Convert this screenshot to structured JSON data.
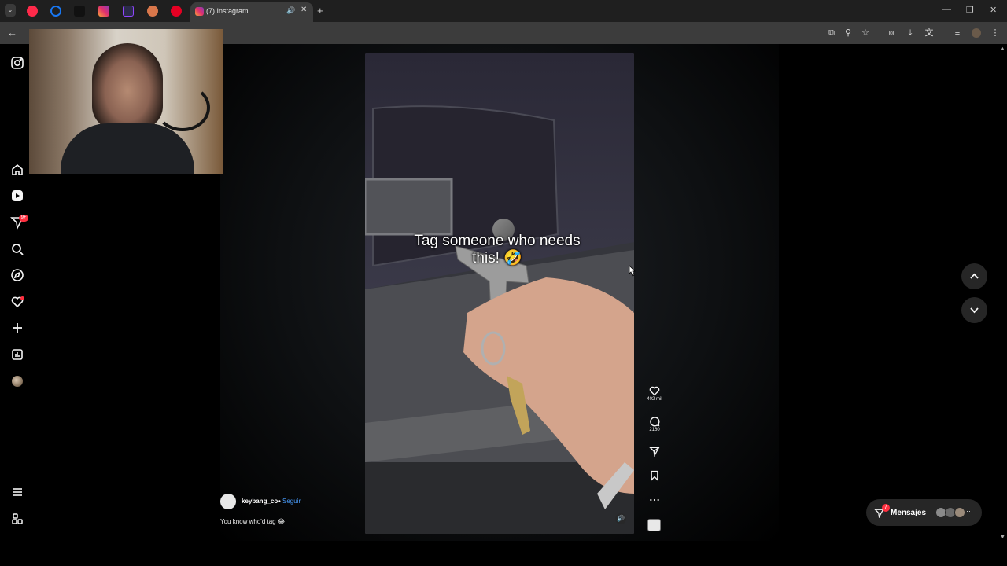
{
  "browser": {
    "tab_title": "(7) Instagram",
    "tab_close": "✕",
    "new_tab": "+",
    "window_controls": [
      "—",
      "❐",
      "✕"
    ]
  },
  "overlay": {
    "caption_line1": "Tag someone who needs",
    "caption_line2": "this! 🤣"
  },
  "actions": {
    "likes": "402 mil",
    "comments": "2160"
  },
  "post": {
    "username": "keybang_co",
    "separator": "•",
    "follow_label": "Seguir",
    "description": "You know who'd tag 😂"
  },
  "messages": {
    "label": "Mensajes",
    "badge": "7"
  },
  "nav": {
    "notifications_badge": "9+"
  },
  "colors": {
    "accent_blue": "#4a9eff",
    "badge_red": "#ff3040",
    "panel": "#262626"
  }
}
